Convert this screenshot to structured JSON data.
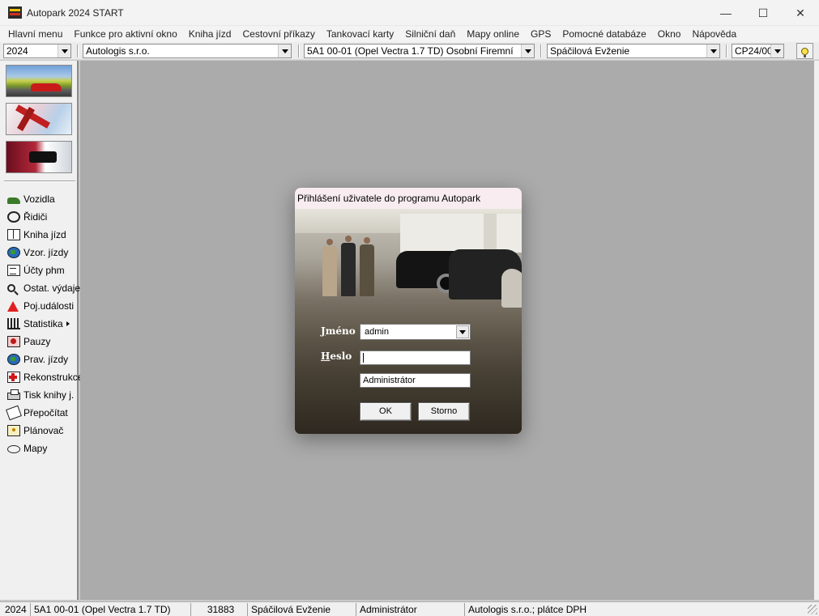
{
  "window": {
    "title": "Autopark 2024 START",
    "minimize": "—",
    "maximize": "☐",
    "close": "✕"
  },
  "menu": [
    "Hlavní menu",
    "Funkce pro aktivní okno",
    "Kniha jízd",
    "Cestovní příkazy",
    "Tankovací karty",
    "Silniční daň",
    "Mapy online",
    "GPS",
    "Pomocné databáze",
    "Okno",
    "Nápověda"
  ],
  "toolbar": {
    "year": "2024",
    "company": "Autologis s.r.o.",
    "vehicle": "5A1 00-01 (Opel Vectra 1.7 TD) Osobní Firemní",
    "driver": "Spáčilová Evženie",
    "trip_order": "CP24/00"
  },
  "sidebar": {
    "items": [
      {
        "label": "Vozidla",
        "icon": "car-icon"
      },
      {
        "label": "Řidiči",
        "icon": "drivers-icon"
      },
      {
        "label": "Kniha jízd",
        "icon": "book-icon"
      },
      {
        "label": "Vzor. jízdy",
        "icon": "globe-icon"
      },
      {
        "label": "Účty phm",
        "icon": "bill-icon"
      },
      {
        "label": "Ostat. výdaje",
        "icon": "search-icon"
      },
      {
        "label": "Poj.události",
        "icon": "warning-icon"
      },
      {
        "label": "Statistika",
        "icon": "stats-icon"
      },
      {
        "label": "Pauzy",
        "icon": "pause-icon"
      },
      {
        "label": "Prav. jízdy",
        "icon": "globe-icon"
      },
      {
        "label": "Rekonstrukce",
        "icon": "reconstruction-icon"
      },
      {
        "label": "Tisk knihy j.",
        "icon": "print-icon"
      },
      {
        "label": "Přepočítat",
        "icon": "recalculate-icon"
      },
      {
        "label": "Plánovač",
        "icon": "planner-icon"
      },
      {
        "label": "Mapy",
        "icon": "map-icon"
      }
    ]
  },
  "dialog": {
    "title": "Přihlášení uživatele do programu Autopark",
    "name_label_ul": "J",
    "name_label_rest": "méno",
    "password_label_ul": "H",
    "password_label_rest": "eslo",
    "username": "admin",
    "password": "",
    "full_name": "Administrátor",
    "ok_label": "OK",
    "cancel_label": "Storno"
  },
  "status": {
    "year": "2024",
    "vehicle": "5A1 00-01 (Opel Vectra 1.7 TD)",
    "number": "31883",
    "driver": "Spáčilová Evženie",
    "user": "Administrátor",
    "company": "Autologis s.r.o.;  plátce DPH"
  }
}
